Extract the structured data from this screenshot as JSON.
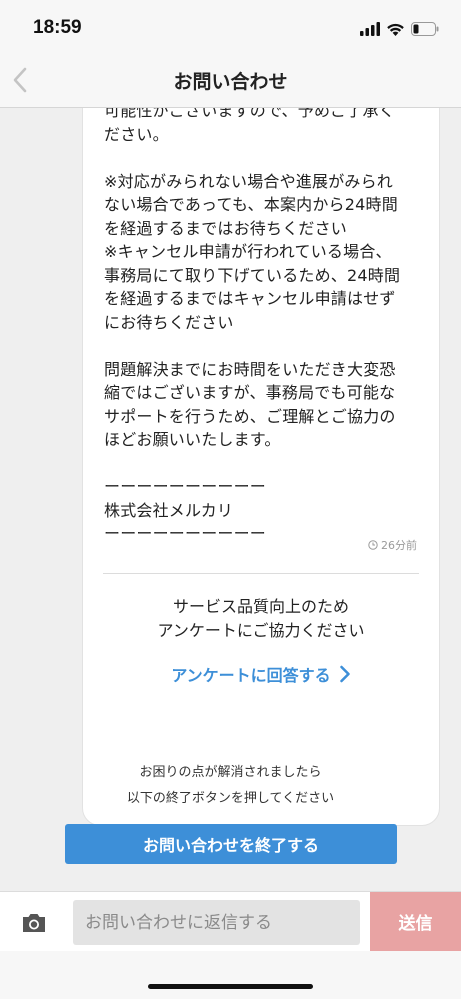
{
  "status_bar": {
    "time": "18:59"
  },
  "header": {
    "title": "お問い合わせ"
  },
  "message": {
    "body": "可能性がございますので、予めご了承く\nださい。\n\n※対応がみられない場合や進展がみられ\nない場合であっても、本案内から24時間\nを経過するまではお待ちください\n※キャンセル申請が行われている場合、\n事務局にて取り下げているため、24時間\nを経過するまではキャンセル申請はせず\nにお待ちください\n\n問題解決までにお時間をいただき大変恐\n縮ではございますが、事務局でも可能な\nサポートを行うため、ご理解とご協力の\nほどお願いいたします。\n\nーーーーーーーーーー\n株式会社メルカリ\nーーーーーーーーーー",
    "timestamp": "26分前"
  },
  "survey": {
    "text": "サービス品質向上のため\nアンケートにご協力ください",
    "link_label": "アンケートに回答する"
  },
  "close_section": {
    "note": "お困りの点が解消されましたら\n以下の終了ボタンを押してください",
    "button_label": "お問い合わせを終了する"
  },
  "input_bar": {
    "placeholder": "お問い合わせに返信する",
    "send_label": "送信"
  },
  "colors": {
    "accent": "#3d8fd8",
    "send_disabled": "#e8a3a3",
    "background": "#efefef"
  },
  "icons": {
    "back": "chevron-left-icon",
    "clock": "clock-icon",
    "camera": "camera-icon",
    "link": "chevron-right-icon"
  }
}
